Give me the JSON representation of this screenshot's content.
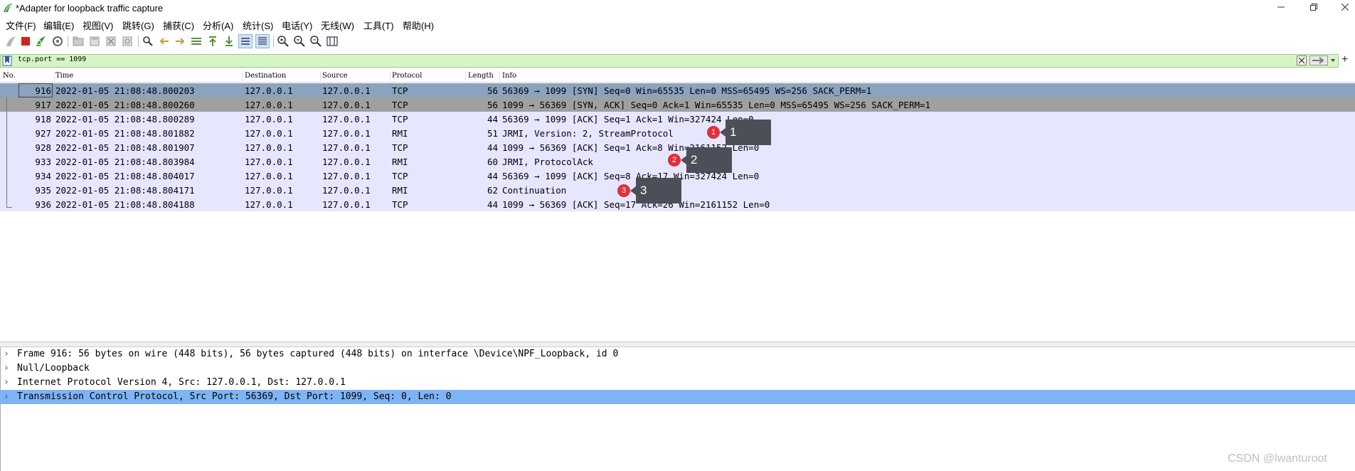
{
  "window": {
    "title": "*Adapter for loopback traffic capture",
    "controls": [
      "minimize",
      "restore",
      "close"
    ]
  },
  "menu": [
    "文件(F)",
    "编辑(E)",
    "视图(V)",
    "跳转(G)",
    "捕获(C)",
    "分析(A)",
    "统计(S)",
    "电话(Y)",
    "无线(W)",
    "工具(T)",
    "帮助(H)"
  ],
  "toolbar": {
    "icons": [
      "start-capture-icon",
      "stop-capture-icon",
      "restart-capture-icon",
      "capture-options-icon",
      "open-file-icon",
      "save-file-icon",
      "close-file-icon",
      "reload-file-icon",
      "find-packet-icon",
      "go-back-icon",
      "go-forward-icon",
      "go-to-packet-icon",
      "go-first-icon",
      "go-last-icon",
      "autoscroll-icon",
      "colorize-icon",
      "zoom-in-icon",
      "zoom-out-icon",
      "normal-size-icon",
      "resize-columns-icon"
    ]
  },
  "filter": {
    "value": "tcp.port == 1099"
  },
  "packet_list": {
    "columns": [
      "No.",
      "Time",
      "Destination",
      "Source",
      "Protocol",
      "Length",
      "Info"
    ],
    "rows": [
      {
        "no": "916",
        "time": "2022-01-05 21:08:48.800203",
        "dst": "127.0.0.1",
        "src": "127.0.0.1",
        "proto": "TCP",
        "len": "56",
        "info": "56369 → 1099 [SYN] Seq=0 Win=65535 Len=0 MSS=65495 WS=256 SACK_PERM=1",
        "bg": "#8ba3be"
      },
      {
        "no": "917",
        "time": "2022-01-05 21:08:48.800260",
        "dst": "127.0.0.1",
        "src": "127.0.0.1",
        "proto": "TCP",
        "len": "56",
        "info": "1099 → 56369 [SYN, ACK] Seq=0 Ack=1 Win=65535 Len=0 MSS=65495 WS=256 SACK_PERM=1",
        "bg": "#a0a0a0"
      },
      {
        "no": "918",
        "time": "2022-01-05 21:08:48.800289",
        "dst": "127.0.0.1",
        "src": "127.0.0.1",
        "proto": "TCP",
        "len": "44",
        "info": "56369 → 1099 [ACK] Seq=1 Ack=1 Win=327424 Len=0",
        "bg": "#e7e6ff"
      },
      {
        "no": "927",
        "time": "2022-01-05 21:08:48.801882",
        "dst": "127.0.0.1",
        "src": "127.0.0.1",
        "proto": "RMI",
        "len": "51",
        "info": "JRMI, Version: 2, StreamProtocol",
        "bg": "#e7e6ff"
      },
      {
        "no": "928",
        "time": "2022-01-05 21:08:48.801907",
        "dst": "127.0.0.1",
        "src": "127.0.0.1",
        "proto": "TCP",
        "len": "44",
        "info": "1099 → 56369 [ACK] Seq=1 Ack=8 Win=2161152 Len=0",
        "bg": "#e7e6ff"
      },
      {
        "no": "933",
        "time": "2022-01-05 21:08:48.803984",
        "dst": "127.0.0.1",
        "src": "127.0.0.1",
        "proto": "RMI",
        "len": "60",
        "info": "JRMI, ProtocolAck",
        "bg": "#e7e6ff"
      },
      {
        "no": "934",
        "time": "2022-01-05 21:08:48.804017",
        "dst": "127.0.0.1",
        "src": "127.0.0.1",
        "proto": "TCP",
        "len": "44",
        "info": "56369 → 1099 [ACK] Seq=8 Ack=17 Win=327424 Len=0",
        "bg": "#e7e6ff"
      },
      {
        "no": "935",
        "time": "2022-01-05 21:08:48.804171",
        "dst": "127.0.0.1",
        "src": "127.0.0.1",
        "proto": "RMI",
        "len": "62",
        "info": "Continuation",
        "bg": "#e7e6ff"
      },
      {
        "no": "936",
        "time": "2022-01-05 21:08:48.804188",
        "dst": "127.0.0.1",
        "src": "127.0.0.1",
        "proto": "TCP",
        "len": "44",
        "info": "1099 → 56369 [ACK] Seq=17 Ack=26 Win=2161152 Len=0",
        "bg": "#e7e6ff"
      }
    ]
  },
  "annotations": [
    {
      "badge": "1",
      "label": "1"
    },
    {
      "badge": "2",
      "label": "2"
    },
    {
      "badge": "3",
      "label": "3"
    }
  ],
  "details": [
    {
      "text": "Frame 916: 56 bytes on wire (448 bits), 56 bytes captured (448 bits) on interface \\Device\\NPF_Loopback, id 0",
      "selected": false
    },
    {
      "text": "Null/Loopback",
      "selected": false
    },
    {
      "text": "Internet Protocol Version 4, Src: 127.0.0.1, Dst: 127.0.0.1",
      "selected": false
    },
    {
      "text": "Transmission Control Protocol, Src Port: 56369, Dst Port: 1099, Seq: 0, Len: 0",
      "selected": true
    }
  ],
  "watermark": "CSDN @lwanturoot"
}
